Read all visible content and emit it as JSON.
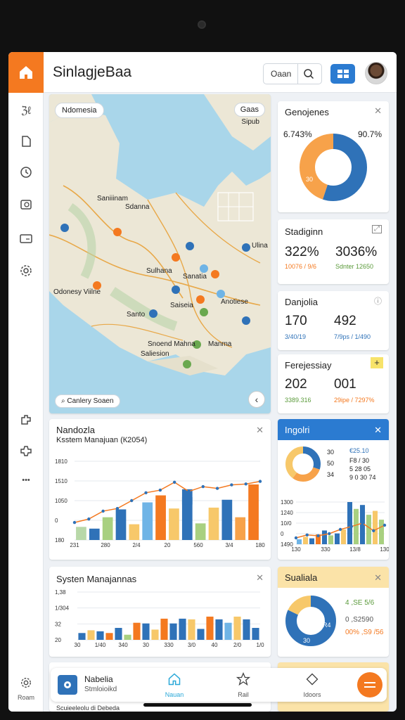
{
  "app": {
    "title": "SinlagjeBaa",
    "search_label": "Oaan",
    "home_icon": "home-icon",
    "grid_icon": "grid-icon"
  },
  "sidebar": {
    "items": [
      {
        "icon": "hierarchy-icon",
        "glyph": "ℨℓ"
      },
      {
        "icon": "document-icon"
      },
      {
        "icon": "clock-icon"
      },
      {
        "icon": "storage-icon"
      },
      {
        "icon": "card-icon"
      },
      {
        "icon": "settings-icon"
      },
      {
        "icon": "puzzle-icon"
      },
      {
        "icon": "puzzle-alt-icon"
      },
      {
        "icon": "more-icon",
        "glyph": "•••"
      }
    ],
    "roam_label": "Roam"
  },
  "map": {
    "region_label": "Ndomesia",
    "layer_button": "Gaas",
    "layer_sub": "Sipub",
    "search_label": "Canlery Soaen",
    "place_labels": [
      "Saniiinam",
      "Sdanna",
      "Sulhana",
      "Sanatia",
      "Ulina",
      "Anotiese",
      "Saiseia",
      "Odonesy Viilne",
      "Santo",
      "Manma",
      "Snoend Mahna",
      "Saliesion"
    ]
  },
  "cards": {
    "donut": {
      "title": "Genojenes",
      "left_pct": "6.743%",
      "right_pct": "90.7%",
      "inner_label": "30",
      "segments": [
        0.55,
        0.45
      ],
      "colors": [
        "#2f72b8",
        "#f7a24a"
      ]
    },
    "stadiginn": {
      "title": "Stadiginn",
      "value_a": "322%",
      "value_b": "3036%",
      "sub_a": "10076 / 9/6",
      "sub_b": "Sdnter 12650"
    },
    "danjolia": {
      "title": "Danjolia",
      "value_a": "170",
      "value_b": "492",
      "sub_a": "3/40/19",
      "sub_b": "7/9ps / 1/490"
    },
    "perejessiay": {
      "title": "Ferejessiay",
      "value_a": "202",
      "value_b": "001",
      "sub_a": "3389.316",
      "sub_b": "29ipe / 7297%"
    },
    "ingolri": {
      "title": "Ingolri",
      "legend_left": [
        "30",
        "50",
        "34"
      ],
      "legend_right": [
        "€25.10",
        "F8 / 30",
        "5 28 05",
        "9 0 30 74"
      ],
      "donut_segments": [
        0.3,
        0.3,
        0.4
      ],
      "donut_colors": [
        "#2f72b8",
        "#f7a24a",
        "#f7c86a"
      ]
    },
    "sualiala": {
      "title": "Sualiala",
      "value_a": "4 ,SE 5/6",
      "value_b": "0 ,S2590",
      "value_c": "00% ,S9 /56",
      "inner_label_a": "R4",
      "inner_label_b": "30",
      "donut_segments": [
        0.82,
        0.18
      ],
      "donut_colors": [
        "#2f72b8",
        "#f7c86a"
      ]
    },
    "nandozla": {
      "title": "Nandozla",
      "subtitle": "Ksstem Manajuan (К2054)"
    },
    "systen": {
      "title": "Systen Manajannas"
    },
    "bottom_caption": "Scuieeleolu di Debeda"
  },
  "chart_data": [
    {
      "type": "bar",
      "title": "Nandozla",
      "subtitle": "Ksstem Manajuan (К2054)",
      "y_ticks": [
        "1810",
        "1510",
        "1050",
        "0",
        "180"
      ],
      "x_ticks": [
        "231",
        "280",
        "2/4",
        "20",
        "560",
        "3/4",
        "180"
      ],
      "ylim": [
        0,
        1800
      ],
      "series": [
        {
          "name": "",
          "values": [
            300,
            260,
            520,
            700,
            360,
            860,
            1020,
            720,
            980,
            380,
            740,
            920,
            520,
            1270
          ]
        },
        {
          "name": "",
          "values": [
            0,
            0,
            0,
            0,
            0,
            0,
            0,
            0,
            1160,
            0,
            0,
            0,
            0,
            0
          ]
        }
      ],
      "line": {
        "values": [
          400,
          480,
          660,
          720,
          900,
          1080,
          1140,
          1320,
          1110,
          1220,
          1180,
          1260,
          1280,
          1340
        ]
      },
      "bar_colors": [
        "#b8d8a8",
        "#2f72b8",
        "#a8d080",
        "#2f72b8",
        "#f7c86a",
        "#6fb4e6",
        "#f47920",
        "#f7c86a",
        "#2f72b8",
        "#a8d080",
        "#f7c86a",
        "#2f72b8",
        "#f7a24a",
        "#f47920"
      ]
    },
    {
      "type": "bar",
      "title": "Systen Manajannas",
      "y_ticks": [
        "1,38",
        "1/304",
        "32",
        "20"
      ],
      "x_ticks": [
        "30",
        "1/40",
        "340",
        "30",
        "330",
        "3/0",
        "40",
        "2/0",
        "1/0"
      ],
      "ylim": [
        0,
        1.4
      ],
      "values": [
        0.2,
        0.28,
        0.25,
        0.2,
        0.35,
        0.15,
        0.5,
        0.48,
        0.3,
        0.62,
        0.48,
        0.62,
        0.6,
        0.32,
        0.68,
        0.6,
        0.5,
        0.68,
        0.6,
        0.35
      ],
      "bar_colors": [
        "#2f72b8",
        "#f7c86a",
        "#2f72b8",
        "#f47920",
        "#2f72b8",
        "#a8d080",
        "#f47920",
        "#2f72b8",
        "#f7c86a",
        "#f47920",
        "#2f72b8",
        "#2f72b8",
        "#f7c86a",
        "#2f72b8",
        "#f47920",
        "#2f72b8",
        "#6fb4e6",
        "#f7c86a",
        "#2f72b8",
        "#2f72b8"
      ]
    },
    {
      "type": "bar",
      "title": "Ingolri",
      "y_ticks": [
        "1300",
        "1240",
        "10/0",
        "0",
        "1490"
      ],
      "x_ticks": [
        "130",
        "330",
        "13/8",
        "130"
      ],
      "values": [
        0.1,
        0.15,
        0.12,
        0.2,
        0.28,
        0.18,
        0.22,
        0.3,
        0.86,
        0.72,
        0.8,
        0.6,
        0.68,
        0.5
      ],
      "line": {
        "values": [
          0.15,
          0.22,
          0.2,
          0.25,
          0.35,
          0.42,
          0.5,
          0.32,
          0.45
        ]
      },
      "bar_colors": [
        "#6fb4e6",
        "#f7c86a",
        "#2f72b8",
        "#f47920",
        "#2f72b8",
        "#a8d080",
        "#2f72b8",
        "#f7c86a",
        "#2f72b8",
        "#a8d080",
        "#2f72b8",
        "#a8d080",
        "#f7c86a",
        "#a8d080"
      ]
    }
  ],
  "bottom_nav": {
    "app_name": "Nabelia",
    "app_sub": "Stmloioikd",
    "items": [
      {
        "label": "Nauan",
        "icon": "home-icon",
        "active": true
      },
      {
        "label": "Rail",
        "icon": "star-icon",
        "active": false
      },
      {
        "label": "Idoors",
        "icon": "diamond-icon",
        "active": false
      }
    ],
    "fab_icon": "menu-icon"
  },
  "colors": {
    "accent_orange": "#f47920",
    "accent_blue": "#2b7bd1"
  }
}
